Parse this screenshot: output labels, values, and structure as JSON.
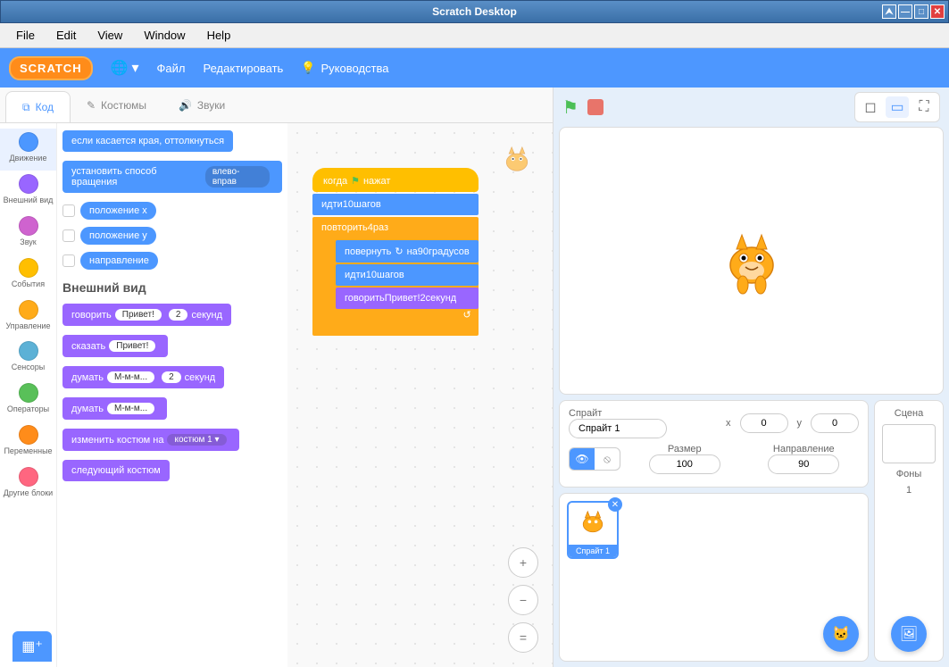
{
  "window": {
    "title": "Scratch Desktop"
  },
  "menubar": [
    "File",
    "Edit",
    "View",
    "Window",
    "Help"
  ],
  "header": {
    "logo": "SCRATCH",
    "file": "Файл",
    "edit": "Редактировать",
    "tutorials": "Руководства"
  },
  "tabs": {
    "code": "Код",
    "costumes": "Костюмы",
    "sounds": "Звуки"
  },
  "categories": [
    {
      "name": "Движение",
      "color": "#4c97ff",
      "active": true
    },
    {
      "name": "Внешний вид",
      "color": "#9966ff"
    },
    {
      "name": "Звук",
      "color": "#cf63cf"
    },
    {
      "name": "События",
      "color": "#ffbf00"
    },
    {
      "name": "Управление",
      "color": "#ffab19"
    },
    {
      "name": "Сенсоры",
      "color": "#5cb1d6"
    },
    {
      "name": "Операторы",
      "color": "#59c059"
    },
    {
      "name": "Переменные",
      "color": "#ff8c1a"
    },
    {
      "name": "Другие блоки",
      "color": "#ff6680"
    }
  ],
  "palette": {
    "motion_edge": "если касается края, оттолкнуться",
    "motion_rotstyle_pre": "установить способ вращения",
    "motion_rotstyle_val": "влево-вправ",
    "rep_x": "положение x",
    "rep_y": "положение y",
    "rep_dir": "направление",
    "looks_title": "Внешний вид",
    "say_for_pre": "говорить",
    "say_for_val": "Привет!",
    "say_for_sec": "2",
    "say_for_post": "секунд",
    "say_pre": "сказать",
    "say_val": "Привет!",
    "think_for_pre": "думать",
    "think_for_val": "М-м-м...",
    "think_for_sec": "2",
    "think_for_post": "секунд",
    "think_pre": "думать",
    "think_val": "М-м-м...",
    "switch_costume_pre": "изменить костюм на",
    "switch_costume_val": "костюм 1",
    "next_costume": "следующий костюм"
  },
  "script": {
    "hat_pre": "когда",
    "hat_post": "нажат",
    "move_pre": "идти",
    "move_val": "10",
    "move_post": "шагов",
    "repeat_pre": "повторить",
    "repeat_val": "4",
    "repeat_post": "раз",
    "turn_pre": "повернуть",
    "turn_mid": "на",
    "turn_val": "90",
    "turn_post": "градусов",
    "move2_pre": "идти",
    "move2_val": "10",
    "move2_post": "шагов",
    "say_pre": "говорить",
    "say_val": "Привет!",
    "say_sec": "2",
    "say_post": "секунд"
  },
  "sprite_info": {
    "title": "Спрайт",
    "name": "Спрайт 1",
    "x_label": "x",
    "x": "0",
    "y_label": "y",
    "y": "0",
    "size_label": "Размер",
    "size": "100",
    "dir_label": "Направление",
    "dir": "90"
  },
  "sprites": [
    {
      "name": "Спрайт 1"
    }
  ],
  "scene": {
    "title": "Сцена",
    "backdrops_label": "Фоны",
    "backdrops_count": "1"
  }
}
